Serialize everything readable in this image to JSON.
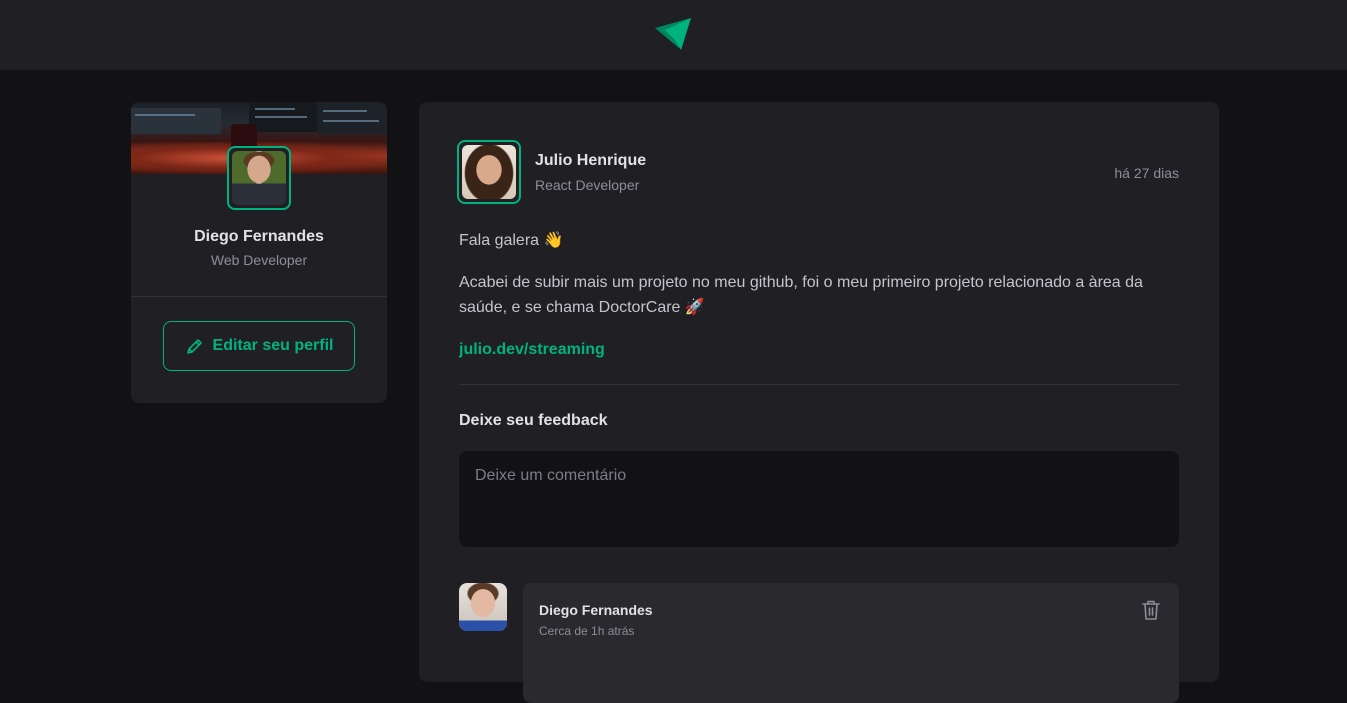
{
  "header": {
    "logo_icon": "ignite-logo-icon"
  },
  "sidebar": {
    "name": "Diego Fernandes",
    "role": "Web Developer",
    "edit_button_label": "Editar seu perfil",
    "edit_icon": "pencil-icon"
  },
  "post": {
    "author_name": "Julio Henrique",
    "author_role": "React Developer",
    "published": "há 27 dias",
    "paragraphs": [
      "Fala galera 👋",
      "Acabei de subir mais um projeto no meu github, foi o meu primeiro projeto relacionado a àrea da saúde, e se chama DoctorCare 🚀"
    ],
    "link": "julio.dev/streaming",
    "feedback_title": "Deixe seu feedback",
    "comment_placeholder": "Deixe um comentário"
  },
  "comments": [
    {
      "author": "Diego Fernandes",
      "time": "Cerca de 1h atrás",
      "delete_icon": "trash-icon"
    }
  ],
  "colors": {
    "accent": "#00b37e",
    "background": "#121214",
    "card": "#202024",
    "comment_card": "#29292e"
  }
}
